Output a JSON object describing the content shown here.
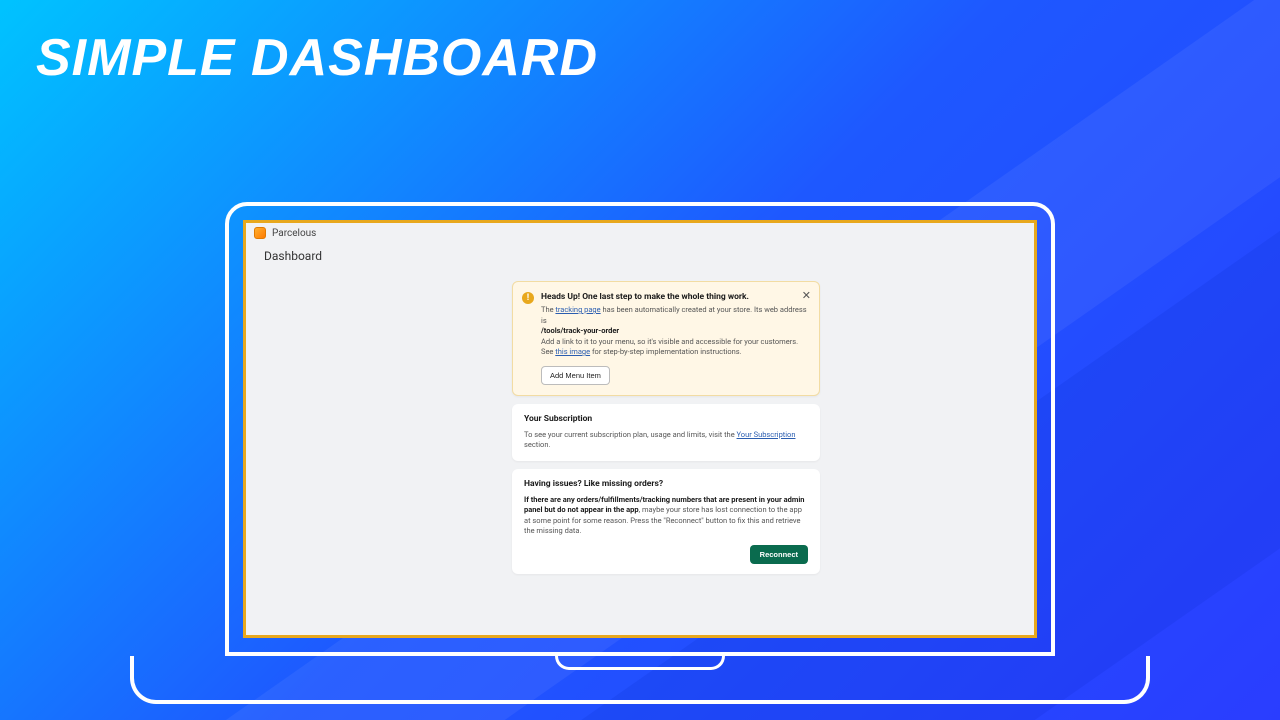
{
  "promo_title": "SIMPLE DASHBOARD",
  "app": {
    "name": "Parcelous"
  },
  "page": {
    "title": "Dashboard"
  },
  "banner": {
    "heading": "Heads Up! One last step to make the whole thing work.",
    "text_prefix": "The ",
    "link1": "tracking page",
    "text_mid": " has been automatically created at your store. Its web address is ",
    "path": "/tools/track-your-order",
    "line2": "Add a link to it to your menu, so it's visible and accessible for your customers.",
    "line3_prefix": "See ",
    "line3_link": "this image",
    "line3_suffix": " for step-by-step implementation instructions.",
    "button": "Add Menu Item"
  },
  "subscription": {
    "heading": "Your Subscription",
    "text_prefix": "To see your current subscription plan, usage and limits, visit the ",
    "link": "Your Subscription",
    "text_suffix": " section."
  },
  "issues": {
    "heading": "Having issues? Like missing orders?",
    "bold": "If there are any orders/fulfillments/tracking numbers that are present in your admin panel but do not appear in the app",
    "rest": ", maybe your store has lost connection to the app at some point for some reason. Press the \"Reconnect\" button to fix this and retrieve the missing data.",
    "button": "Reconnect"
  }
}
